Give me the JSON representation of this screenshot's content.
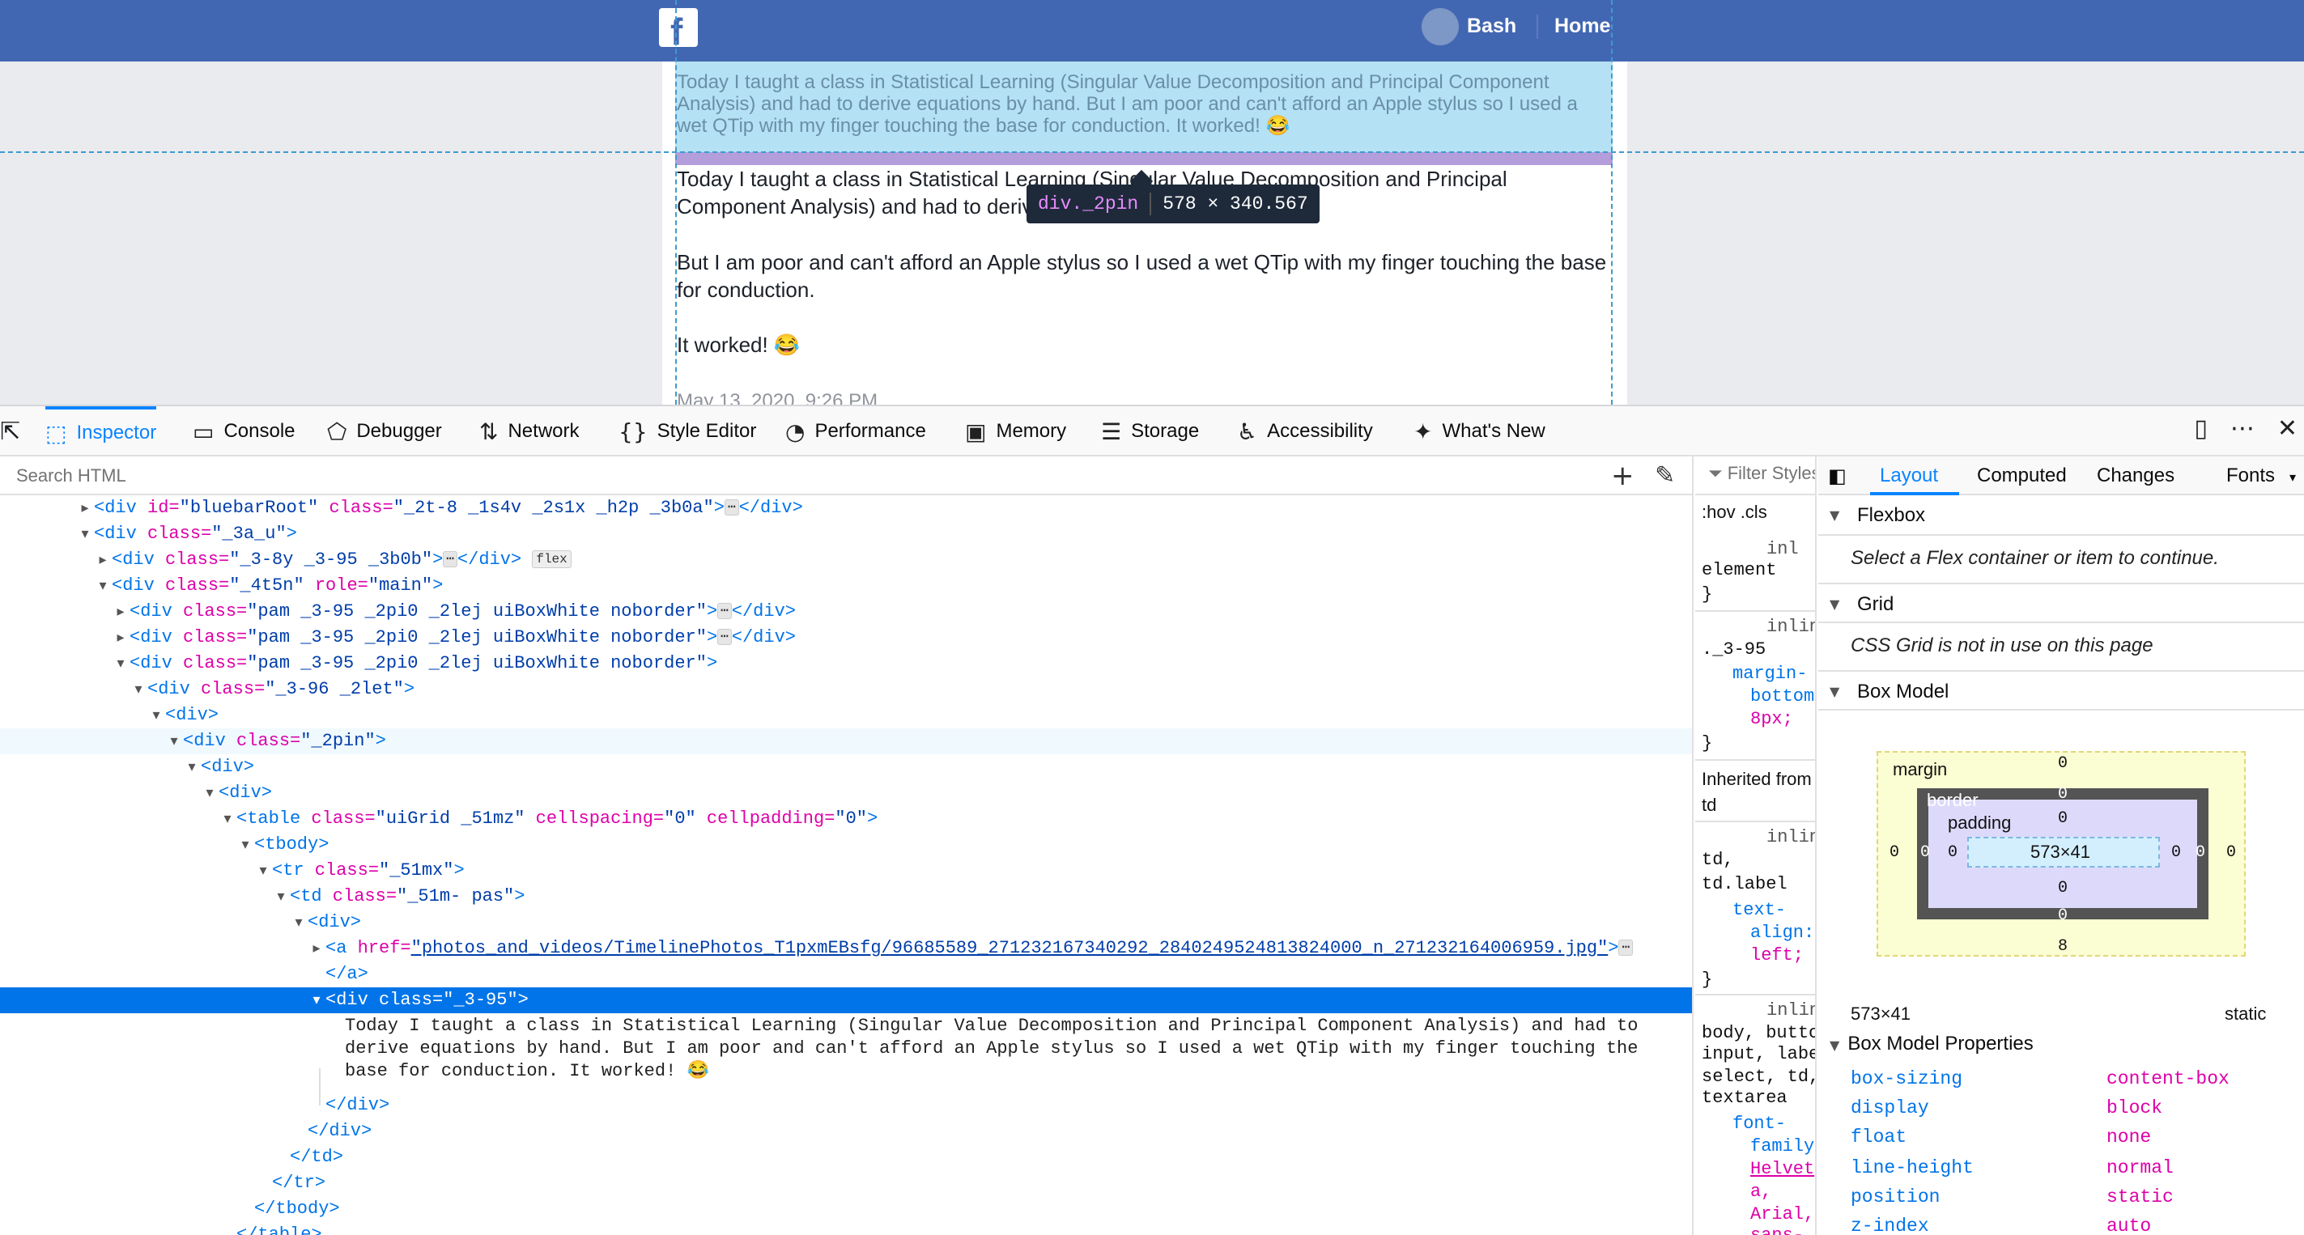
{
  "page": {
    "nav": {
      "name": "Bash",
      "home": "Home",
      "logo": "f"
    },
    "ghost_text": "Today I taught a class in Statistical Learning (Singular Value Decomposition and Principal Component Analysis) and had to derive equations by hand. But I am poor and can't afford an Apple stylus so I used a wet QTip with my finger touching the base for conduction. It worked! 😂",
    "post_p1": "Today I taught a class in Statistical Learning (Singular Value Decomposition and Principal Component Analysis) and had to derive equations by hand.",
    "post_p2": "But I am poor and can't afford an Apple stylus so I used a wet QTip with my finger touching the base for conduction.",
    "post_p3": "It worked! 😂",
    "post_date": "May 13, 2020, 9:26 PM",
    "tooltip": {
      "selector": "div._2pin",
      "size": "578 × 340.567"
    }
  },
  "toolbar": {
    "tabs": [
      {
        "label": "Inspector",
        "icon": "inspector-icon"
      },
      {
        "label": "Console",
        "icon": "console-icon"
      },
      {
        "label": "Debugger",
        "icon": "debugger-icon"
      },
      {
        "label": "Network",
        "icon": "network-icon"
      },
      {
        "label": "Style Editor",
        "icon": "style-editor-icon"
      },
      {
        "label": "Performance",
        "icon": "performance-icon"
      },
      {
        "label": "Memory",
        "icon": "memory-icon"
      },
      {
        "label": "Storage",
        "icon": "storage-icon"
      },
      {
        "label": "Accessibility",
        "icon": "accessibility-icon"
      },
      {
        "label": "What's New",
        "icon": "whats-new-icon"
      }
    ]
  },
  "markup": {
    "search_placeholder": "Search HTML",
    "text_node": "Today I taught a class in Statistical Learning (Singular Value Decomposition and Principal Component Analysis) and had to derive equations by hand. But I am poor and can't afford an Apple stylus so I used a wet QTip with my finger touching the base for conduction. It worked! 😂",
    "rows": {
      "r0": {
        "open": "<div",
        "a1": " id=",
        "v1": "\"bluebarRoot\"",
        "a2": " class=",
        "v2": "\"_2t-8 _1s4v _2s1x _h2p _3b0a\"",
        "close": ">",
        "end": "</div>"
      },
      "r1": {
        "open": "<div",
        "a1": " class=",
        "v1": "\"_3a_u\"",
        "close": ">"
      },
      "r2": {
        "open": "<div",
        "a1": " class=",
        "v1": "\"_3-8y _3-95 _3b0b\"",
        "close": ">",
        "end": "</div>",
        "badge": "flex"
      },
      "r3": {
        "open": "<div",
        "a1": " class=",
        "v1": "\"_4t5n\"",
        "a2": " role=",
        "v2": "\"main\"",
        "close": ">"
      },
      "r4": {
        "open": "<div",
        "a1": " class=",
        "v1": "\"pam _3-95 _2pi0 _2lej uiBoxWhite noborder\"",
        "close": ">",
        "end": "</div>"
      },
      "r5": {
        "open": "<div",
        "a1": " class=",
        "v1": "\"pam _3-95 _2pi0 _2lej uiBoxWhite noborder\"",
        "close": ">",
        "end": "</div>"
      },
      "r6": {
        "open": "<div",
        "a1": " class=",
        "v1": "\"pam _3-95 _2pi0 _2lej uiBoxWhite noborder\"",
        "close": ">"
      },
      "r7": {
        "open": "<div",
        "a1": " class=",
        "v1": "\"_3-96 _2let\"",
        "close": ">"
      },
      "r8": {
        "open": "<div>"
      },
      "r9": {
        "open": "<div",
        "a1": " class=",
        "v1": "\"_2pin\"",
        "close": ">"
      },
      "r10": {
        "open": "<div>"
      },
      "r11": {
        "open": "<div>"
      },
      "r12": {
        "open": "<table",
        "a1": " class=",
        "v1": "\"uiGrid _51mz\"",
        "a2": " cellspacing=",
        "v2": "\"0\"",
        "a3": " cellpadding=",
        "v3": "\"0\"",
        "close": ">"
      },
      "r13": {
        "open": "<tbody>"
      },
      "r14": {
        "open": "<tr",
        "a1": " class=",
        "v1": "\"_51mx\"",
        "close": ">"
      },
      "r15": {
        "open": "<td",
        "a1": " class=",
        "v1": "\"_51m- pas\"",
        "close": ">"
      },
      "r16": {
        "open": "<div>"
      },
      "r17": {
        "open": "<a",
        "a1": " href=",
        "v1": "\"photos_and_videos/TimelinePhotos_T1pxmEBsfg/96685589_271232167340292_2840249524813824000_n_271232164006959.jpg\"",
        "close": ">"
      },
      "r18": {
        "open": "</a>"
      },
      "r19": {
        "open": "<div",
        "a1": " class=",
        "v1": "\"_3-95\"",
        "close": ">"
      },
      "r20": {
        "open": "</div>"
      },
      "r21": {
        "open": "</div>"
      },
      "r22": {
        "open": "</td>"
      },
      "r23": {
        "open": "</tr>"
      },
      "r24": {
        "open": "</tbody>"
      },
      "r25": {
        "open": "</table>"
      }
    },
    "ellipsis": "⋯"
  },
  "rules": {
    "filter_placeholder": "Filter Styles",
    "hov": ":hov  .cls",
    "lines": {
      "l1": "inl",
      "l2": "element",
      "l3": "}",
      "l4": "inlin",
      "l5": "._3-95",
      "l6": "margin-",
      "l7": "bottom",
      "l8": "8px;",
      "l9": "}",
      "l10": "Inherited from",
      "l11": "td",
      "l12": "inlin",
      "l13": "td,",
      "l14": "td.label",
      "l15": "text-",
      "l16": "align:",
      "l17": "left;",
      "l18": "}",
      "l19": "inlin",
      "l20": "body, butto",
      "l21": "input, label",
      "l22": "select, td,",
      "l23": "textarea",
      "l24": "font-",
      "l25": "family",
      "l26": "Helvet",
      "l27": "a,",
      "l28": "Arial,",
      "l29": "sans-"
    }
  },
  "layout_panel": {
    "tabs": [
      "Layout",
      "Computed",
      "Changes",
      "Fonts"
    ],
    "flexbox": "Flexbox",
    "flexbox_msg": "Select a Flex container or item to continue.",
    "grid": "Grid",
    "grid_msg": "CSS Grid is not in use on this page",
    "box_model": "Box Model",
    "bm": {
      "margin_label": "margin",
      "border_label": "border",
      "padding_label": "padding",
      "content": "573×41",
      "margin_top": "0",
      "margin_bottom": "8",
      "margin_left": "0",
      "margin_right": "0",
      "border_top": "0",
      "border_bottom": "0",
      "border_left": "0",
      "border_right": "0",
      "padding_top": "0",
      "padding_bottom": "0",
      "padding_left": "0",
      "padding_right": "0"
    },
    "dims": "573×41",
    "position": "static",
    "props_head": "Box Model Properties",
    "props": [
      {
        "name": "box-sizing",
        "value": "content-box"
      },
      {
        "name": "display",
        "value": "block"
      },
      {
        "name": "float",
        "value": "none"
      },
      {
        "name": "line-height",
        "value": "normal"
      },
      {
        "name": "position",
        "value": "static"
      },
      {
        "name": "z-index",
        "value": "auto"
      }
    ]
  },
  "colors": {
    "facebook_blue": "#4267b2",
    "devtools_accent": "#0a84ff",
    "selected_row": "#0074e8"
  }
}
